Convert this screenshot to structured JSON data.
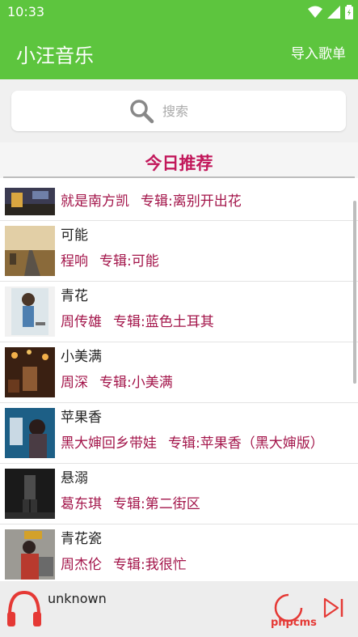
{
  "status": {
    "time": "10:33"
  },
  "appbar": {
    "title": "小汪音乐",
    "import_label": "导入歌单"
  },
  "search": {
    "placeholder": "搜索"
  },
  "recommend": {
    "header": "今日推荐"
  },
  "songs": [
    {
      "title": "",
      "artist": "就是南方凯",
      "album": "专辑:离别开出花"
    },
    {
      "title": "可能",
      "artist": "程响",
      "album": "专辑:可能"
    },
    {
      "title": "青花",
      "artist": "周传雄",
      "album": "专辑:蓝色土耳其"
    },
    {
      "title": "小美满",
      "artist": "周深",
      "album": "专辑:小美满"
    },
    {
      "title": "苹果香",
      "artist": "黑大婶回乡带娃",
      "album": "专辑:苹果香（黑大婶版）"
    },
    {
      "title": "悬溺",
      "artist": "葛东琪",
      "album": "专辑:第二街区"
    },
    {
      "title": "青花瓷",
      "artist": "周杰伦",
      "album": "专辑:我很忙"
    }
  ],
  "player": {
    "song": "unknown",
    "watermark": "phpcms"
  },
  "colors": {
    "primary": "#5dc53e",
    "accent": "#c2185b",
    "meta": "#a3154a",
    "player_icon": "#e53935"
  }
}
